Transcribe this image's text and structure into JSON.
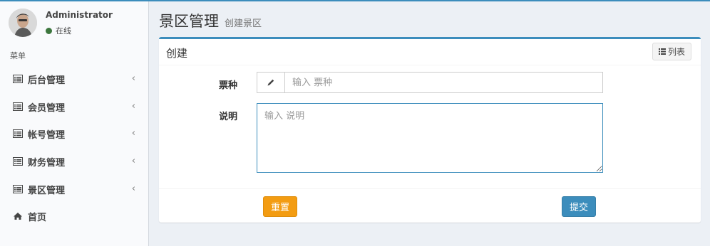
{
  "user": {
    "name": "Administrator",
    "status": "在线"
  },
  "sidebar": {
    "header": "菜单",
    "items": [
      {
        "label": "后台管理",
        "icon": "list-alt-icon",
        "has_chevron": true
      },
      {
        "label": "会员管理",
        "icon": "list-alt-icon",
        "has_chevron": true
      },
      {
        "label": "帐号管理",
        "icon": "list-alt-icon",
        "has_chevron": true
      },
      {
        "label": "财务管理",
        "icon": "list-alt-icon",
        "has_chevron": true
      },
      {
        "label": "景区管理",
        "icon": "list-alt-icon",
        "has_chevron": true
      },
      {
        "label": "首页",
        "icon": "home-icon",
        "has_chevron": false
      }
    ],
    "chevron": "‹"
  },
  "header": {
    "title": "景区管理",
    "subtitle": "创建景区"
  },
  "box": {
    "title": "创建",
    "list_button": "列表"
  },
  "form": {
    "ticket_label": "票种",
    "ticket_placeholder": "输入 票种",
    "desc_label": "说明",
    "desc_placeholder": "输入 说明"
  },
  "footer": {
    "reset": "重置",
    "submit": "提交"
  },
  "colors": {
    "primary": "#3c8dbc",
    "warning": "#f39c12",
    "online": "#3c763d"
  }
}
